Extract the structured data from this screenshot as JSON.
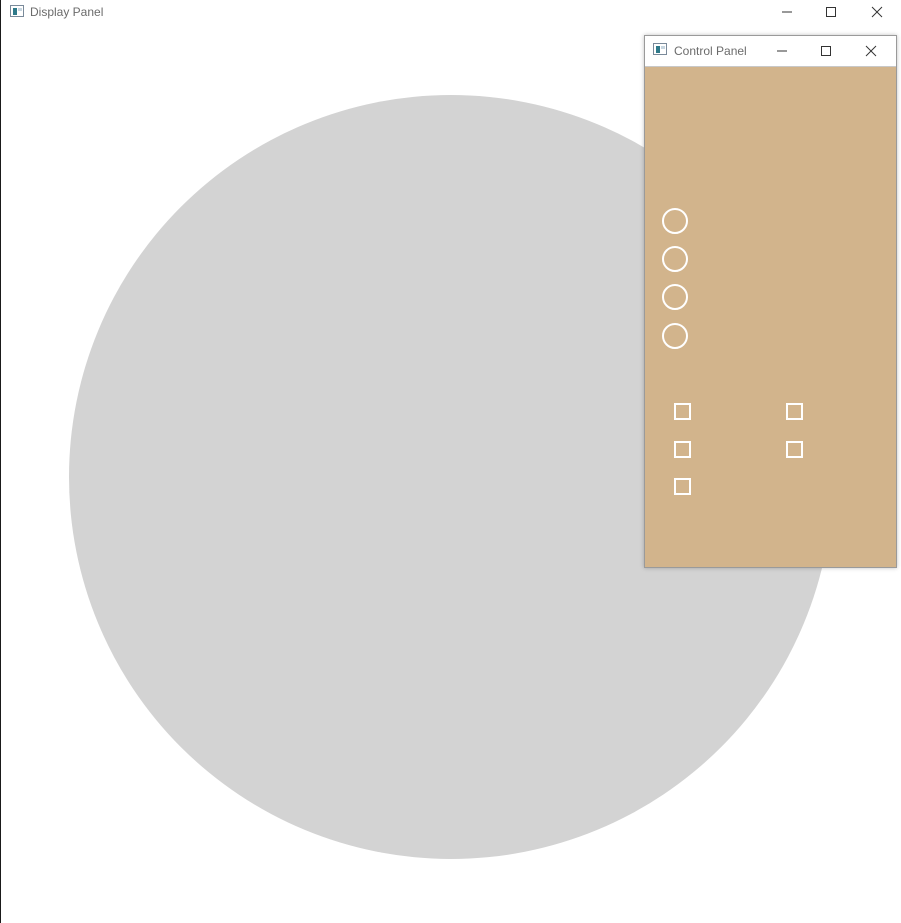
{
  "main_window": {
    "title": "Display Panel",
    "icon": "app-window-icon",
    "canvas": {
      "background": "#ffffff",
      "shape": "circle",
      "shape_color": "#d3d3d3"
    }
  },
  "control_panel": {
    "title": "Control Panel",
    "icon": "app-window-icon",
    "background": "#d2b48c",
    "radio_buttons": [
      {
        "selected": false
      },
      {
        "selected": false
      },
      {
        "selected": false
      },
      {
        "selected": false
      }
    ],
    "checkboxes_left": [
      {
        "checked": false
      },
      {
        "checked": false
      },
      {
        "checked": false
      }
    ],
    "checkboxes_right": [
      {
        "checked": false
      },
      {
        "checked": false
      }
    ]
  },
  "caption_buttons": [
    "minimize-icon",
    "maximize-icon",
    "close-icon"
  ]
}
